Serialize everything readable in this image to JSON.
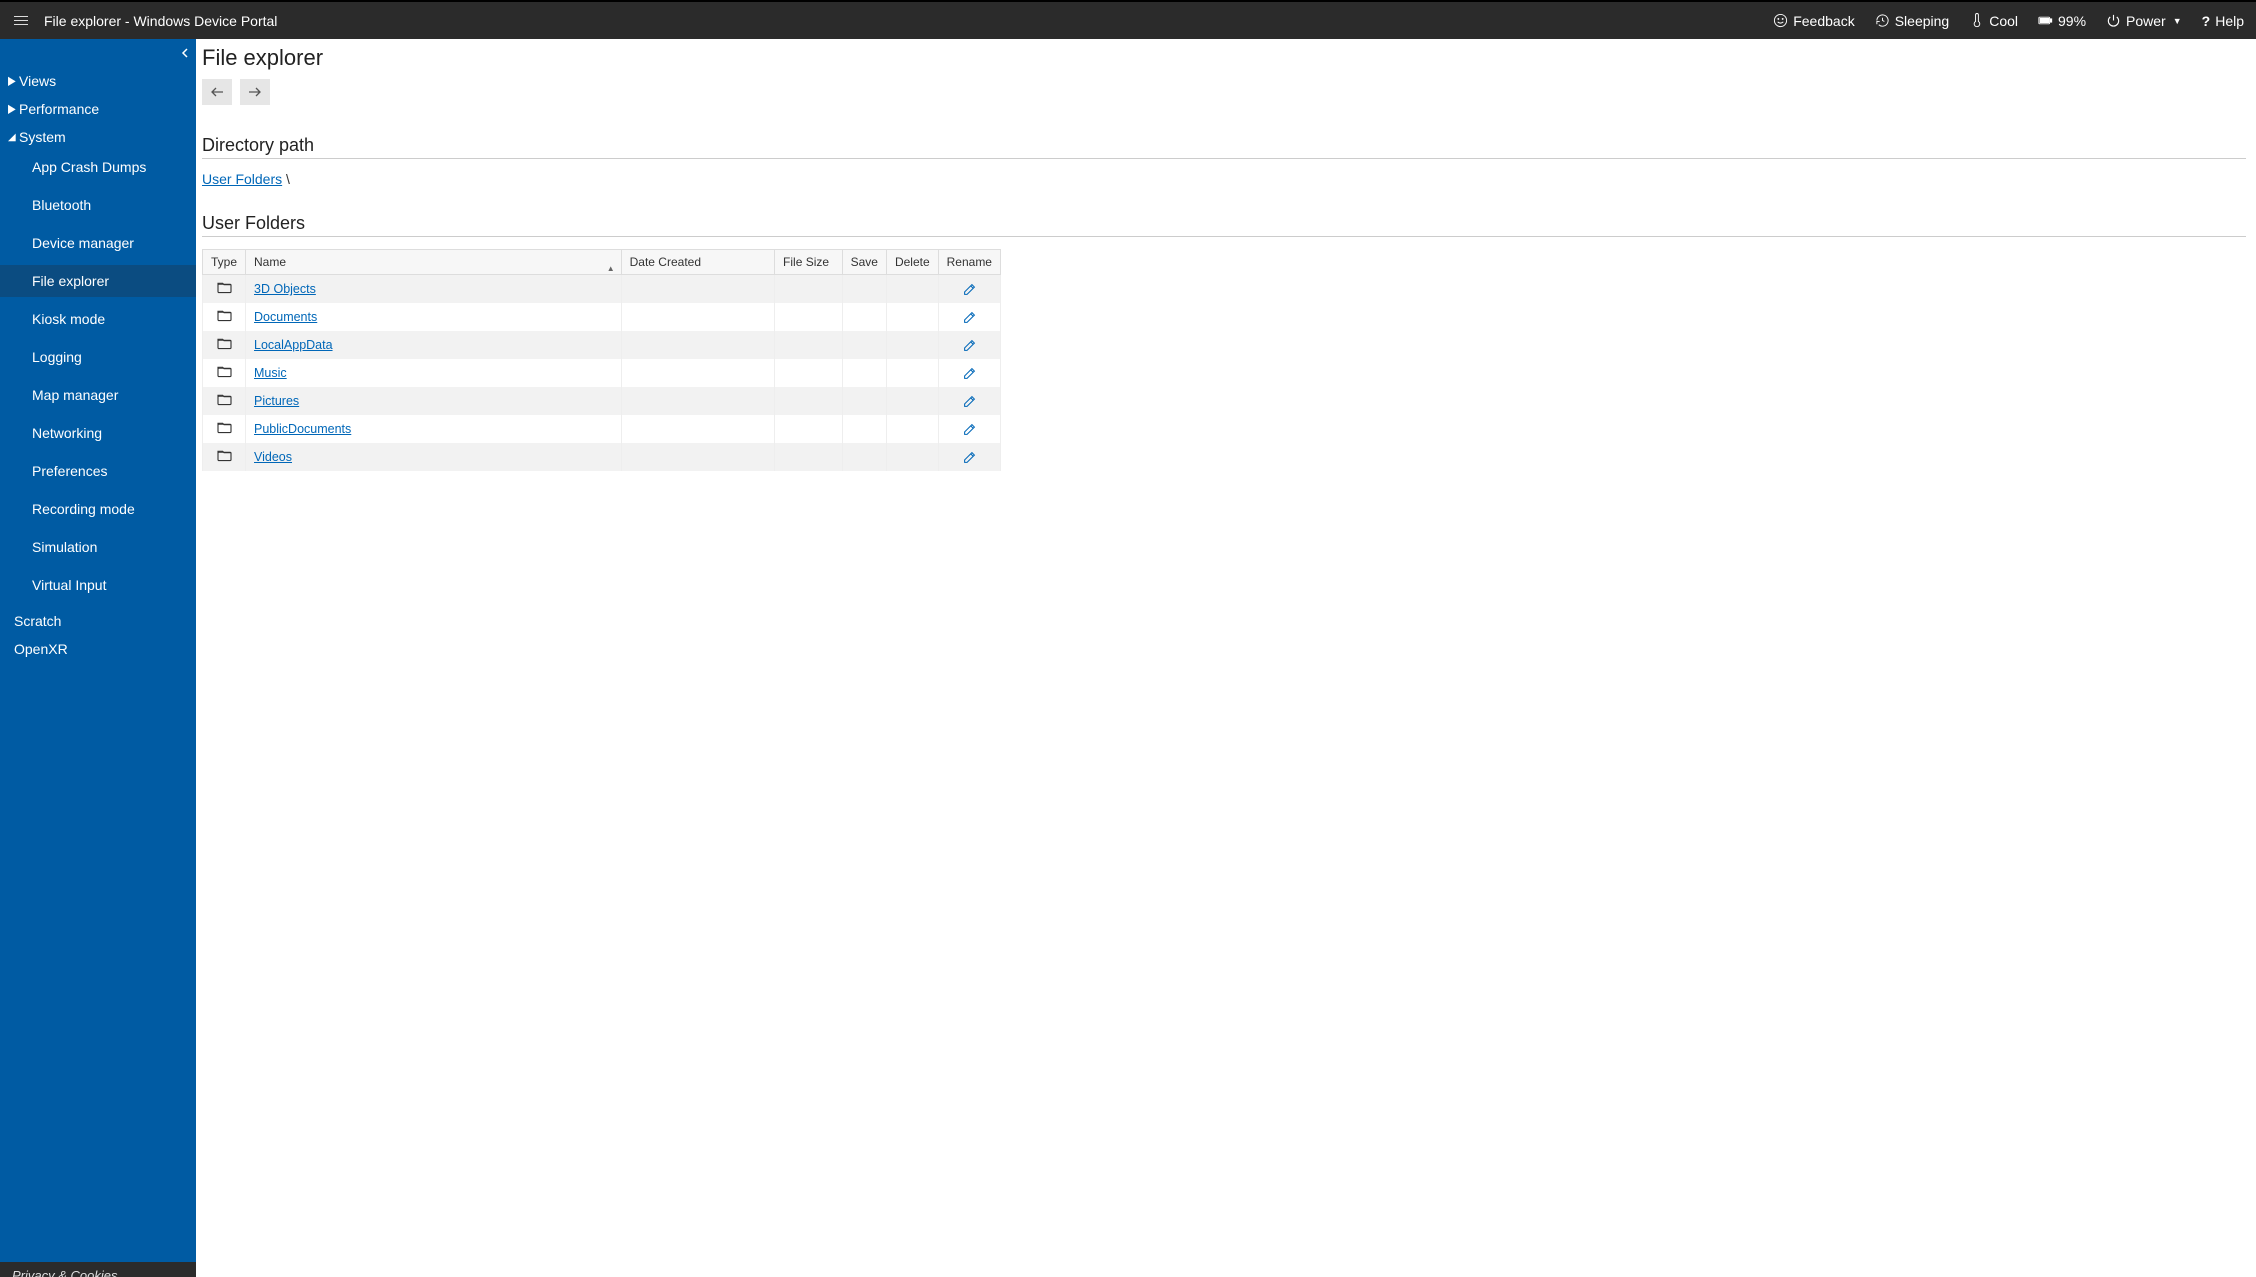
{
  "topbar": {
    "title": "File explorer - Windows Device Portal",
    "feedback": "Feedback",
    "sleeping": "Sleeping",
    "cool": "Cool",
    "battery": "99%",
    "power": "Power",
    "help": "Help"
  },
  "sidebar": {
    "views": "Views",
    "performance": "Performance",
    "system": "System",
    "system_children": [
      "App Crash Dumps",
      "Bluetooth",
      "Device manager",
      "File explorer",
      "Kiosk mode",
      "Logging",
      "Map manager",
      "Networking",
      "Preferences",
      "Recording mode",
      "Simulation",
      "Virtual Input"
    ],
    "scratch": "Scratch",
    "openxr": "OpenXR",
    "footer": "Privacy & Cookies"
  },
  "main": {
    "page_title": "File explorer",
    "directory_path_title": "Directory path",
    "breadcrumb_root": "User Folders",
    "breadcrumb_sep": " \\",
    "listing_title": "User Folders",
    "columns": {
      "type": "Type",
      "name": "Name",
      "date": "Date Created",
      "size": "File Size",
      "save": "Save",
      "delete": "Delete",
      "rename": "Rename"
    },
    "rows": [
      {
        "name": "3D Objects"
      },
      {
        "name": "Documents"
      },
      {
        "name": "LocalAppData"
      },
      {
        "name": "Music"
      },
      {
        "name": "Pictures"
      },
      {
        "name": "PublicDocuments"
      },
      {
        "name": "Videos"
      }
    ]
  }
}
